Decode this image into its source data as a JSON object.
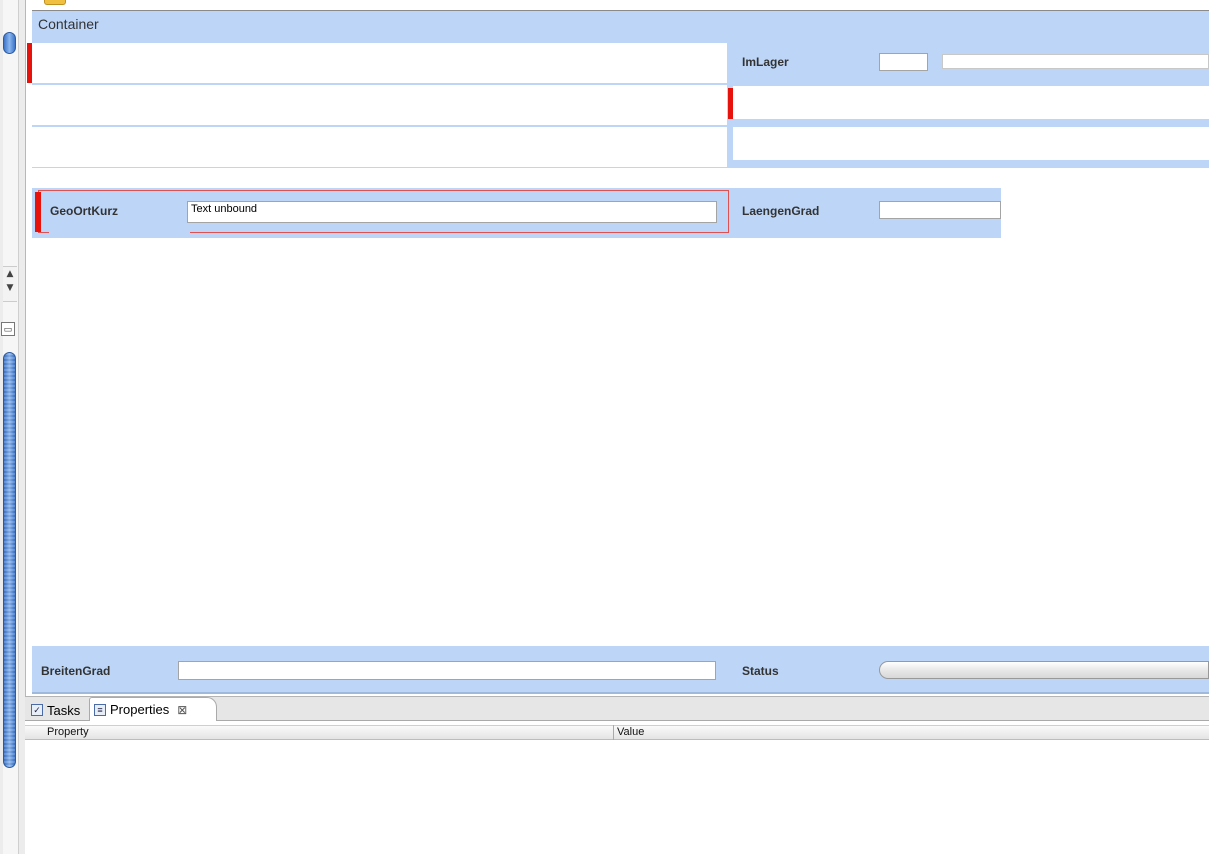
{
  "container": {
    "title": "Container"
  },
  "fields": {
    "imlager": {
      "label": "ImLager",
      "value": ""
    },
    "geoortkurz": {
      "label": "GeoOrtKurz",
      "value": "Text unbound"
    },
    "laengengrad": {
      "label": "LaengenGrad",
      "value": ""
    },
    "breitengrad": {
      "label": "BreitenGrad",
      "value": ""
    },
    "status": {
      "label": "Status"
    }
  },
  "bottom_panel": {
    "tabs": [
      {
        "label": "Tasks",
        "icon": "tasks-icon"
      },
      {
        "label": "Properties",
        "icon": "properties-icon",
        "active": true
      }
    ],
    "table_headers": {
      "property": "Property",
      "value": "Value"
    }
  },
  "colors": {
    "container_bg": "#bdd6f8",
    "error_marker": "#e8120c",
    "selection_border": "#e05050"
  }
}
